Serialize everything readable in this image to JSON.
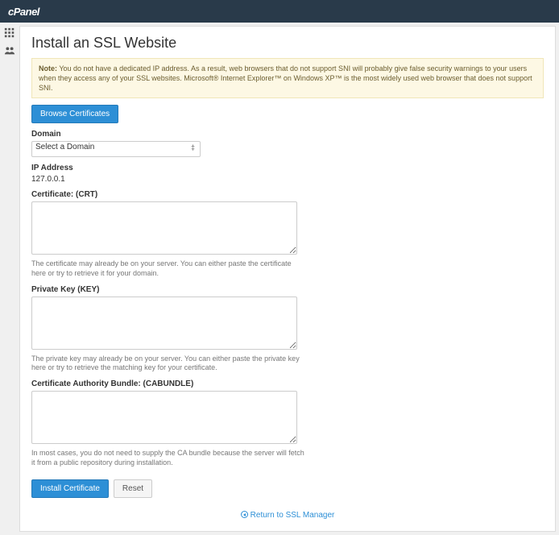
{
  "logo": "cPanel",
  "page_title": "Install an SSL Website",
  "note": {
    "prefix": "Note:",
    "text": " You do not have a dedicated IP address. As a result, web browsers that do not support SNI will probably give false security warnings to your users when they access any of your SSL websites. Microsoft® Internet Explorer™ on Windows XP™ is the most widely used web browser that does not support SNI."
  },
  "buttons": {
    "browse": "Browse Certificates",
    "install": "Install Certificate",
    "reset": "Reset"
  },
  "domain": {
    "label": "Domain",
    "selected": "Select a Domain"
  },
  "ip": {
    "label": "IP Address",
    "value": "127.0.0.1"
  },
  "crt": {
    "label": "Certificate: (CRT)",
    "hint": "The certificate may already be on your server. You can either paste the certificate here or try to retrieve it for your domain."
  },
  "key": {
    "label": "Private Key (KEY)",
    "hint": "The private key may already be on your server. You can either paste the private key here or try to retrieve the matching key for your certificate."
  },
  "cab": {
    "label": "Certificate Authority Bundle: (CABUNDLE)",
    "hint": "In most cases, you do not need to supply the CA bundle because the server will fetch it from a public repository during installation."
  },
  "return_link": "Return to SSL Manager"
}
